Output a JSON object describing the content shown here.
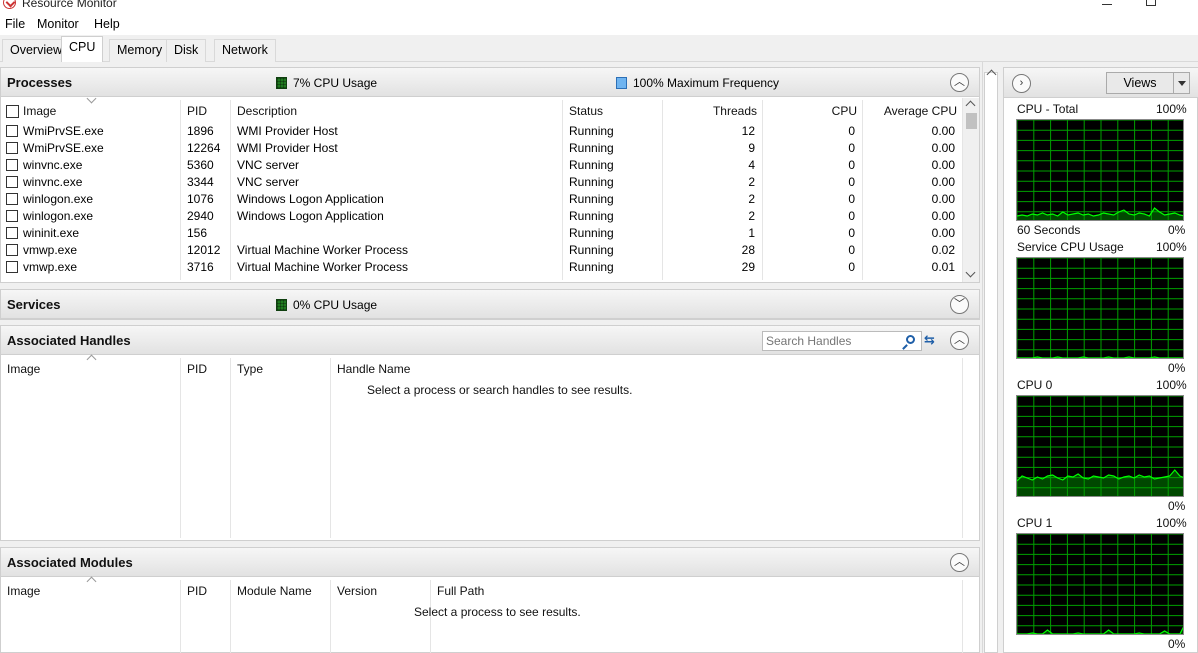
{
  "window": {
    "title": "Resource Monitor"
  },
  "menu": [
    "File",
    "Monitor",
    "Help"
  ],
  "tabs": [
    "Overview",
    "CPU",
    "Memory",
    "Disk",
    "Network"
  ],
  "active_tab": "CPU",
  "processes": {
    "title": "Processes",
    "cpu_usage_label": "7% CPU Usage",
    "max_freq_label": "100% Maximum Frequency",
    "columns": [
      "Image",
      "PID",
      "Description",
      "Status",
      "Threads",
      "CPU",
      "Average CPU"
    ],
    "rows": [
      {
        "image": "WmiPrvSE.exe",
        "pid": "1896",
        "description": "WMI Provider Host",
        "status": "Running",
        "threads": "12",
        "cpu": "0",
        "avg_cpu": "0.00"
      },
      {
        "image": "WmiPrvSE.exe",
        "pid": "12264",
        "description": "WMI Provider Host",
        "status": "Running",
        "threads": "9",
        "cpu": "0",
        "avg_cpu": "0.00"
      },
      {
        "image": "winvnc.exe",
        "pid": "5360",
        "description": "VNC server",
        "status": "Running",
        "threads": "4",
        "cpu": "0",
        "avg_cpu": "0.00"
      },
      {
        "image": "winvnc.exe",
        "pid": "3344",
        "description": "VNC server",
        "status": "Running",
        "threads": "2",
        "cpu": "0",
        "avg_cpu": "0.00"
      },
      {
        "image": "winlogon.exe",
        "pid": "1076",
        "description": "Windows Logon Application",
        "status": "Running",
        "threads": "2",
        "cpu": "0",
        "avg_cpu": "0.00"
      },
      {
        "image": "winlogon.exe",
        "pid": "2940",
        "description": "Windows Logon Application",
        "status": "Running",
        "threads": "2",
        "cpu": "0",
        "avg_cpu": "0.00"
      },
      {
        "image": "wininit.exe",
        "pid": "156",
        "description": "",
        "status": "Running",
        "threads": "1",
        "cpu": "0",
        "avg_cpu": "0.00"
      },
      {
        "image": "vmwp.exe",
        "pid": "12012",
        "description": "Virtual Machine Worker Process",
        "status": "Running",
        "threads": "28",
        "cpu": "0",
        "avg_cpu": "0.02"
      },
      {
        "image": "vmwp.exe",
        "pid": "3716",
        "description": "Virtual Machine Worker Process",
        "status": "Running",
        "threads": "29",
        "cpu": "0",
        "avg_cpu": "0.01"
      }
    ]
  },
  "services": {
    "title": "Services",
    "cpu_usage_label": "0% CPU Usage"
  },
  "handles": {
    "title": "Associated Handles",
    "search_placeholder": "Search Handles",
    "columns": [
      "Image",
      "PID",
      "Type",
      "Handle Name"
    ],
    "empty_message": "Select a process or search handles to see results."
  },
  "modules": {
    "title": "Associated Modules",
    "columns": [
      "Image",
      "PID",
      "Module Name",
      "Version",
      "Full Path"
    ],
    "empty_message": "Select a process to see results."
  },
  "right_pane": {
    "views_label": "Views",
    "graphs": [
      {
        "title": "CPU - Total",
        "max_label": "100%",
        "min_label": "0%",
        "footer": "60 Seconds"
      },
      {
        "title": "Service CPU Usage",
        "max_label": "100%",
        "min_label": "0%"
      },
      {
        "title": "CPU 0",
        "max_label": "100%",
        "min_label": "0%"
      },
      {
        "title": "CPU 1",
        "max_label": "100%",
        "min_label": "0%"
      }
    ]
  },
  "colors": {
    "graph_bg": "#000000",
    "graph_grid": "#00a000",
    "graph_line": "#00ff00",
    "header_bg": "#e6e6e6"
  }
}
